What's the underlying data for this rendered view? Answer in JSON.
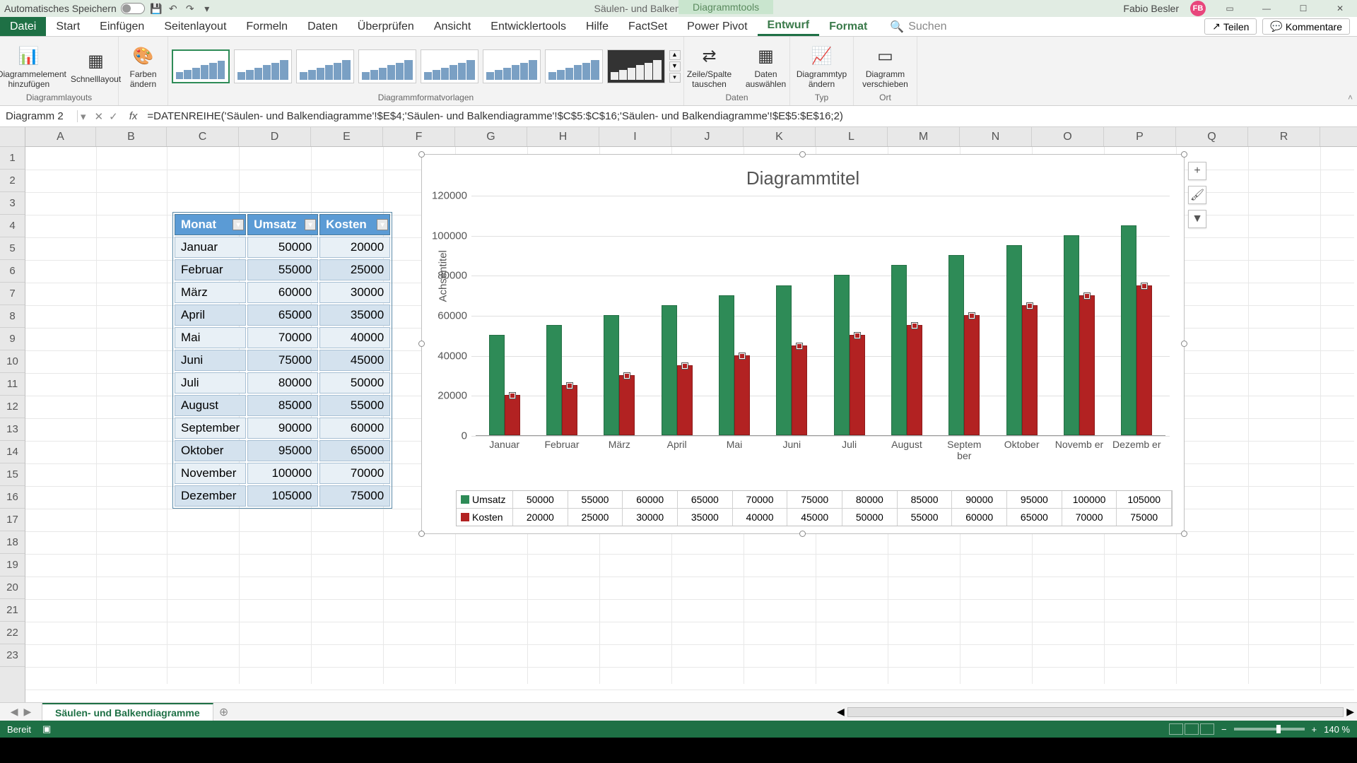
{
  "titlebar": {
    "autosave_label": "Automatisches Speichern",
    "doc_title": "Säulen- und Balkendiagramme - Excel",
    "context_tools": "Diagrammtools",
    "user_name": "Fabio Besler",
    "user_initials": "FB"
  },
  "ribbon": {
    "tabs": [
      "Datei",
      "Start",
      "Einfügen",
      "Seitenlayout",
      "Formeln",
      "Daten",
      "Überprüfen",
      "Ansicht",
      "Entwicklertools",
      "Hilfe",
      "FactSet",
      "Power Pivot",
      "Entwurf",
      "Format"
    ],
    "active_tab": "Entwurf",
    "search_placeholder": "Suchen",
    "share": "Teilen",
    "comments": "Kommentare",
    "groups": {
      "layouts_label": "Diagrammlayouts",
      "add_element": "Diagrammelement hinzufügen",
      "quick_layout": "Schnelllayout",
      "colors": "Farben ändern",
      "styles_label": "Diagrammformatvorlagen",
      "switch_rowcol": "Zeile/Spalte tauschen",
      "select_data": "Daten auswählen",
      "data_label": "Daten",
      "change_type": "Diagrammtyp ändern",
      "type_label": "Typ",
      "move_chart": "Diagramm verschieben",
      "loc_label": "Ort"
    }
  },
  "formula": {
    "name_box": "Diagramm 2",
    "formula": "=DATENREIHE('Säulen- und Balkendiagramme'!$E$4;'Säulen- und Balkendiagramme'!$C$5:$C$16;'Säulen- und Balkendiagramme'!$E$5:$E$16;2)"
  },
  "columns": [
    "A",
    "B",
    "C",
    "D",
    "E",
    "F",
    "G",
    "H",
    "I",
    "J",
    "K",
    "L",
    "M",
    "N",
    "O",
    "P",
    "Q",
    "R"
  ],
  "table": {
    "headers": [
      "Monat",
      "Umsatz",
      "Kosten"
    ],
    "rows": [
      [
        "Januar",
        "50000",
        "20000"
      ],
      [
        "Februar",
        "55000",
        "25000"
      ],
      [
        "März",
        "60000",
        "30000"
      ],
      [
        "April",
        "65000",
        "35000"
      ],
      [
        "Mai",
        "70000",
        "40000"
      ],
      [
        "Juni",
        "75000",
        "45000"
      ],
      [
        "Juli",
        "80000",
        "50000"
      ],
      [
        "August",
        "85000",
        "55000"
      ],
      [
        "September",
        "90000",
        "60000"
      ],
      [
        "Oktober",
        "95000",
        "65000"
      ],
      [
        "November",
        "100000",
        "70000"
      ],
      [
        "Dezember",
        "105000",
        "75000"
      ]
    ]
  },
  "chart_data": {
    "type": "bar",
    "title": "Diagrammtitel",
    "ylabel": "Achsentitel",
    "ylim": [
      0,
      120000
    ],
    "y_ticks": [
      0,
      20000,
      40000,
      60000,
      80000,
      100000,
      120000
    ],
    "categories": [
      "Januar",
      "Februar",
      "März",
      "April",
      "Mai",
      "Juni",
      "Juli",
      "August",
      "September",
      "Oktober",
      "November",
      "Dezember"
    ],
    "x_display": [
      "Januar",
      "Februar",
      "März",
      "April",
      "Mai",
      "Juni",
      "Juli",
      "August",
      "Septem ber",
      "Oktober",
      "Novemb er",
      "Dezemb er"
    ],
    "series": [
      {
        "name": "Umsatz",
        "color": "#2e8b57",
        "values": [
          50000,
          55000,
          60000,
          65000,
          70000,
          75000,
          80000,
          85000,
          90000,
          95000,
          100000,
          105000
        ]
      },
      {
        "name": "Kosten",
        "color": "#b22222",
        "values": [
          20000,
          25000,
          30000,
          35000,
          40000,
          45000,
          50000,
          55000,
          60000,
          65000,
          70000,
          75000
        ]
      }
    ]
  },
  "sheet": {
    "active": "Säulen- und Balkendiagramme"
  },
  "status": {
    "ready": "Bereit",
    "zoom": "140 %"
  }
}
